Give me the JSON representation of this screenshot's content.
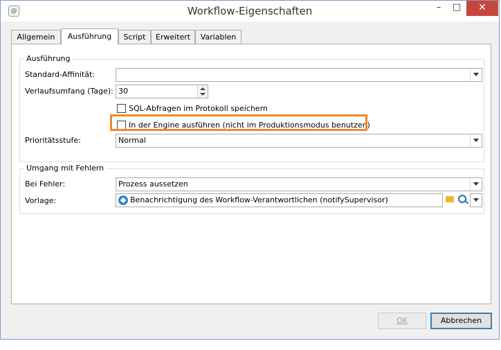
{
  "window": {
    "title": "Workflow-Eigenschaften",
    "app_icon": "@",
    "min_label": "–",
    "max_label": "□",
    "close_label": "✕"
  },
  "tabs": [
    {
      "label": "Allgemein",
      "active": false
    },
    {
      "label": "Ausführung",
      "active": true
    },
    {
      "label": "Script",
      "active": false
    },
    {
      "label": "Erweitert",
      "active": false
    },
    {
      "label": "Variablen",
      "active": false
    }
  ],
  "execution": {
    "group_title": "Ausführung",
    "affinity_label": "Standard-Affinität:",
    "affinity_value": "",
    "history_label": "Verlaufsumfang (Tage):",
    "history_value": "30",
    "sql_checkbox_label": "SQL-Abfragen im Protokoll speichern",
    "sql_checked": false,
    "engine_checkbox_label": "In der Engine ausführen (nicht im Produktionsmodus benutzen)",
    "engine_checked": false,
    "priority_label": "Prioritätsstufe:",
    "priority_value": "Normal"
  },
  "errors": {
    "group_title": "Umgang mit Fehlern",
    "on_error_label": "Bei Fehler:",
    "on_error_value": "Prozess aussetzen",
    "template_label": "Vorlage:",
    "template_value": "Benachrichtigung des Workflow-Verantwortlichen (notifySupervisor)"
  },
  "footer": {
    "ok_label": "OK",
    "ok_enabled": false,
    "cancel_label": "Abbrechen"
  },
  "colors": {
    "highlight": "#f0882c",
    "close_button": "#c7463c",
    "window_border": "#7a9cc9"
  }
}
